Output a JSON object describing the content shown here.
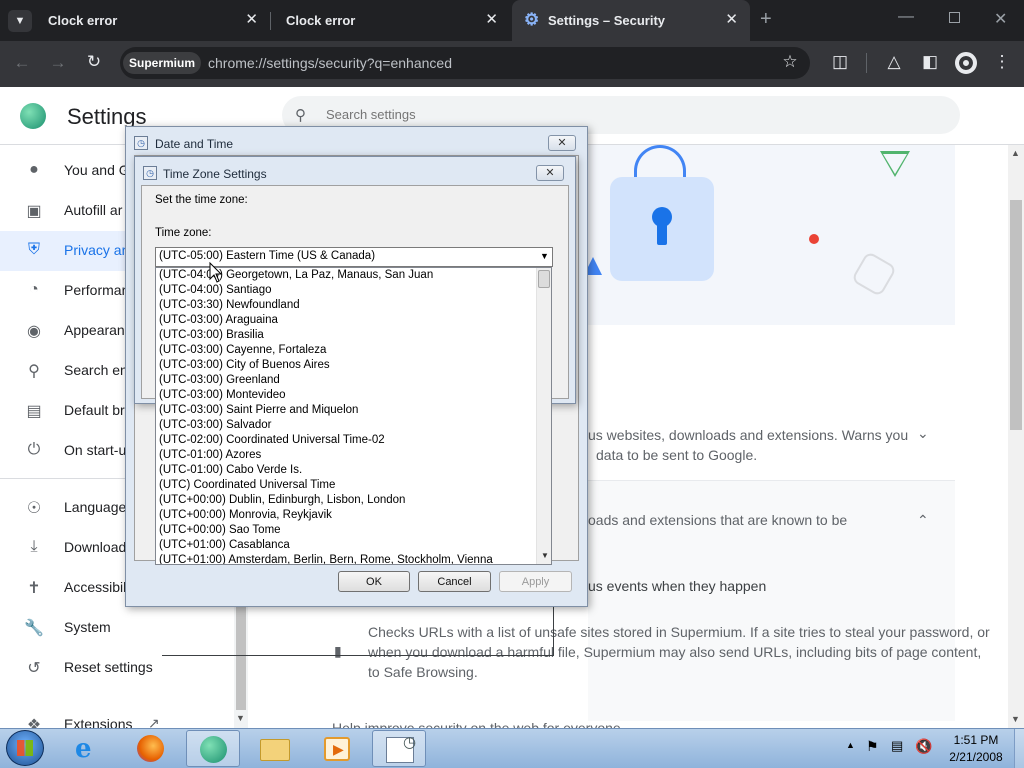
{
  "browser": {
    "tabs": [
      {
        "title": "Clock error"
      },
      {
        "title": "Clock error"
      },
      {
        "title": "Settings – Security"
      }
    ],
    "new_tab_symbol": "+",
    "brand": "Supermium",
    "url": "chrome://settings/security?q=enhanced"
  },
  "settings": {
    "title": "Settings",
    "search_placeholder": "Search settings",
    "nav": [
      {
        "label": "You and G",
        "icon": "person-icon"
      },
      {
        "label": "Autofill ar",
        "icon": "clipboard-icon"
      },
      {
        "label": "Privacy ar",
        "icon": "shield-icon"
      },
      {
        "label": "Performar",
        "icon": "speedometer-icon"
      },
      {
        "label": "Appearan",
        "icon": "palette-icon"
      },
      {
        "label": "Search en",
        "icon": "search-icon"
      },
      {
        "label": "Default br",
        "icon": "browser-icon"
      },
      {
        "label": "On start-u",
        "icon": "power-icon"
      },
      {
        "label": "Language",
        "icon": "globe-icon"
      },
      {
        "label": "Download",
        "icon": "download-icon"
      },
      {
        "label": "Accessibil",
        "icon": "accessibility-icon"
      },
      {
        "label": "System",
        "icon": "wrench-icon"
      },
      {
        "label": "Reset settings",
        "icon": "reset-icon"
      },
      {
        "label": "Extensions",
        "icon": "puzzle-icon"
      }
    ],
    "content": {
      "enhanced_line1": "us websites, downloads and extensions. Warns you",
      "enhanced_line2": "data to be sent to Google.",
      "standard_line": "oads and extensions that are known to be",
      "events_line": "us events when they happen",
      "para_line1": "Checks URLs with a list of unsafe sites stored in Supermium. If a site tries to steal your password, or",
      "para_line2": "when you download a harmful file, Supermium may also send URLs, including bits of page content,",
      "para_line3": "to Safe Browsing.",
      "cut_line": "Help improve security on the web for everyone"
    }
  },
  "date_time_dialog": {
    "title": "Date and Time",
    "buttons": {
      "ok": "OK",
      "cancel": "Cancel",
      "apply": "Apply"
    }
  },
  "tz_dialog": {
    "title": "Time Zone Settings",
    "prompt": "Set the time zone:",
    "label": "Time zone:",
    "selected": "(UTC-05:00) Eastern Time (US & Canada)",
    "options": [
      "(UTC-04:00) Georgetown, La Paz, Manaus, San Juan",
      "(UTC-04:00) Santiago",
      "(UTC-03:30) Newfoundland",
      "(UTC-03:00) Araguaina",
      "(UTC-03:00) Brasilia",
      "(UTC-03:00) Cayenne, Fortaleza",
      "(UTC-03:00) City of Buenos Aires",
      "(UTC-03:00) Greenland",
      "(UTC-03:00) Montevideo",
      "(UTC-03:00) Saint Pierre and Miquelon",
      "(UTC-03:00) Salvador",
      "(UTC-02:00) Coordinated Universal Time-02",
      "(UTC-01:00) Azores",
      "(UTC-01:00) Cabo Verde Is.",
      "(UTC) Coordinated Universal Time",
      "(UTC+00:00) Dublin, Edinburgh, Lisbon, London",
      "(UTC+00:00) Monrovia, Reykjavik",
      "(UTC+00:00) Sao Tome",
      "(UTC+01:00) Casablanca",
      "(UTC+01:00) Amsterdam, Berlin, Bern, Rome, Stockholm, Vienna"
    ]
  },
  "taskbar": {
    "apps": [
      "internet-explorer-icon",
      "firefox-icon",
      "supermium-icon",
      "file-explorer-icon",
      "media-player-icon",
      "date-time-icon"
    ],
    "time": "1:51 PM",
    "date": "2/21/2008"
  },
  "colors": {
    "accent": "#1a73e8",
    "chrome_dark": "#202124",
    "active_nav_bg": "#e8f0fe"
  }
}
